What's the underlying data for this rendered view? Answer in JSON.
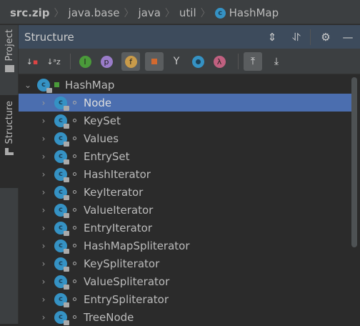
{
  "breadcrumb": [
    "src.zip",
    "java.base",
    "java",
    "util",
    "HashMap"
  ],
  "sidebar": {
    "project": "Project",
    "structure": "Structure"
  },
  "panel": {
    "title": "Structure"
  },
  "toolbar": {
    "buttons": [
      "sort-visibility",
      "sort-alpha",
      "inherited",
      "properties",
      "fields",
      "non-public",
      "anonymous",
      "lambdas",
      "autoscroll-to-source",
      "autoscroll-from-source"
    ]
  },
  "tree": {
    "root": "HashMap",
    "items": [
      "Node",
      "KeySet",
      "Values",
      "EntrySet",
      "HashIterator",
      "KeyIterator",
      "ValueIterator",
      "EntryIterator",
      "HashMapSpliterator",
      "KeySpliterator",
      "ValueSpliterator",
      "EntrySpliterator",
      "TreeNode"
    ],
    "selected": "Node"
  },
  "colors": {
    "selection": "#4b6eaf",
    "class_icon": "#3592c4"
  }
}
